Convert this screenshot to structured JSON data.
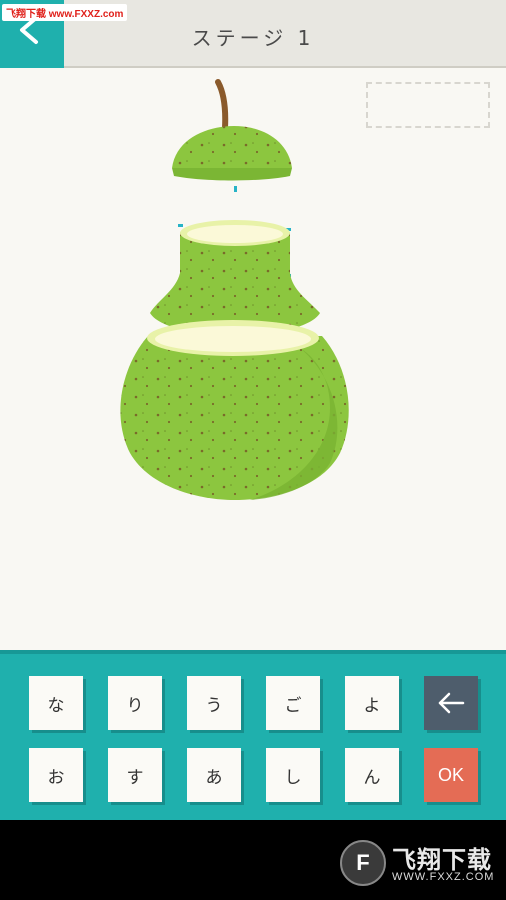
{
  "header": {
    "title": "ステージ 1",
    "back_icon": "chevron-left-icon",
    "watermark": "飞翔下载 www.FXXZ.com"
  },
  "colors": {
    "accent": "#1fb0ad",
    "ok": "#e46c55",
    "backspace": "#4e5d6c",
    "pear": "#8cc63f"
  },
  "answer": {
    "value": ""
  },
  "keyboard": {
    "row1": [
      "な",
      "り",
      "う",
      "ご",
      "よ"
    ],
    "row2": [
      "お",
      "す",
      "あ",
      "し",
      "ん"
    ],
    "backspace_icon": "arrow-left-icon",
    "ok_label": "OK"
  },
  "bottom_watermark": {
    "logo_letter": "F",
    "title": "飞翔下载",
    "url": "WWW.FXXZ.COM"
  }
}
